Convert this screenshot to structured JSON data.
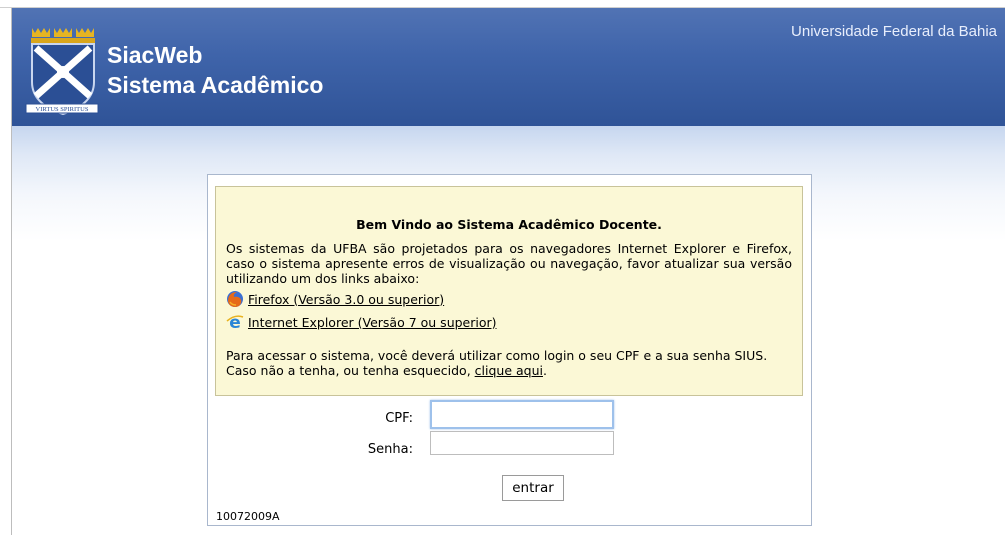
{
  "header": {
    "app_name": "SiacWeb",
    "app_subtitle": "Sistema Acadêmico",
    "university": "Universidade Federal da Bahia",
    "logo_motto": "VIRTUS SPIRITUS",
    "colors": {
      "header_blue": "#3f64aa",
      "notice_yellow": "#fbf8d6"
    }
  },
  "notice": {
    "title": "Bem Vindo ao Sistema Acadêmico Docente.",
    "intro": "Os sistemas da UFBA são projetados para os navegadores Internet Explorer e Firefox, caso o sistema apresente erros de visualização ou navegação, favor atualizar sua versão utilizando um dos links abaixo:",
    "links": [
      {
        "label": "Firefox (Versão 3.0 ou superior)",
        "icon": "firefox-icon"
      },
      {
        "label": "Internet Explorer (Versão 7 ou superior)",
        "icon": "internet-explorer-icon"
      }
    ],
    "access_text": "Para acessar o sistema, você deverá utilizar como login o seu CPF e a sua senha SIUS.",
    "recover_prefix": "Caso não a tenha, ou tenha esquecido, ",
    "recover_link": "clique aqui",
    "recover_suffix": "."
  },
  "login": {
    "cpf_label": "CPF:",
    "cpf_value": "",
    "password_label": "Senha:",
    "password_value": "",
    "submit_label": "entrar"
  },
  "version": "10072009A"
}
